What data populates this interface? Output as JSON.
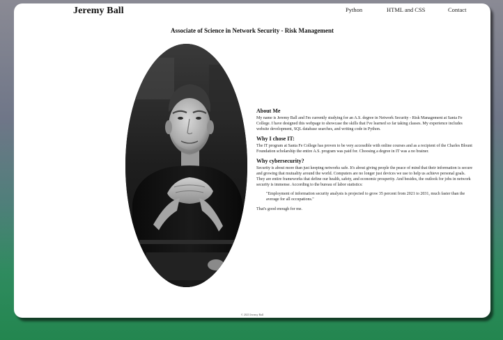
{
  "header": {
    "site_name": "Jeremy Ball",
    "nav": [
      "Python",
      "HTML and CSS",
      "Contact"
    ]
  },
  "main": {
    "title": "Associate of Science in Network Security - Risk Management",
    "sections": [
      {
        "heading": "About Me",
        "body": "My name is Jeremy Ball and I'm currently studying for an A.S. degree in Network Security - Risk Management at Santa Fe College. I have designed this webpage to showcase the skills that I've learned so far taking classes. My experience includes website development, SQL database searches, and writing code in Python."
      },
      {
        "heading": "Why I chose IT:",
        "body": "The IT program at Santa Fe College has proven to be very accessible with online courses and as a recipient of the Charles Blount Foundation scholarship the entire A.S. program was paid for. Choosing a degree in IT was a no brainer."
      },
      {
        "heading": "Why cybersecurity?",
        "body": "Security is about more than just keeping networks safe. It's about giving people the peace of mind that their information is secure and growing that mutuality around the world. Computers are no longer just devices we use to help us achieve personal goals. They are entire frameworks that define our health, safety, and economic prosperity. And besides, the outlook for jobs in network security is immense. According to the bureau of labor statistics:",
        "quote": "\"Employment of information security analysts is projected to grow 35 percent from 2021 to 2031, much faster than the average for all occupations.\"",
        "closing": "That's good enough for me."
      }
    ]
  },
  "footer": {
    "copyright": "© 2023 Jeremy Ball"
  }
}
